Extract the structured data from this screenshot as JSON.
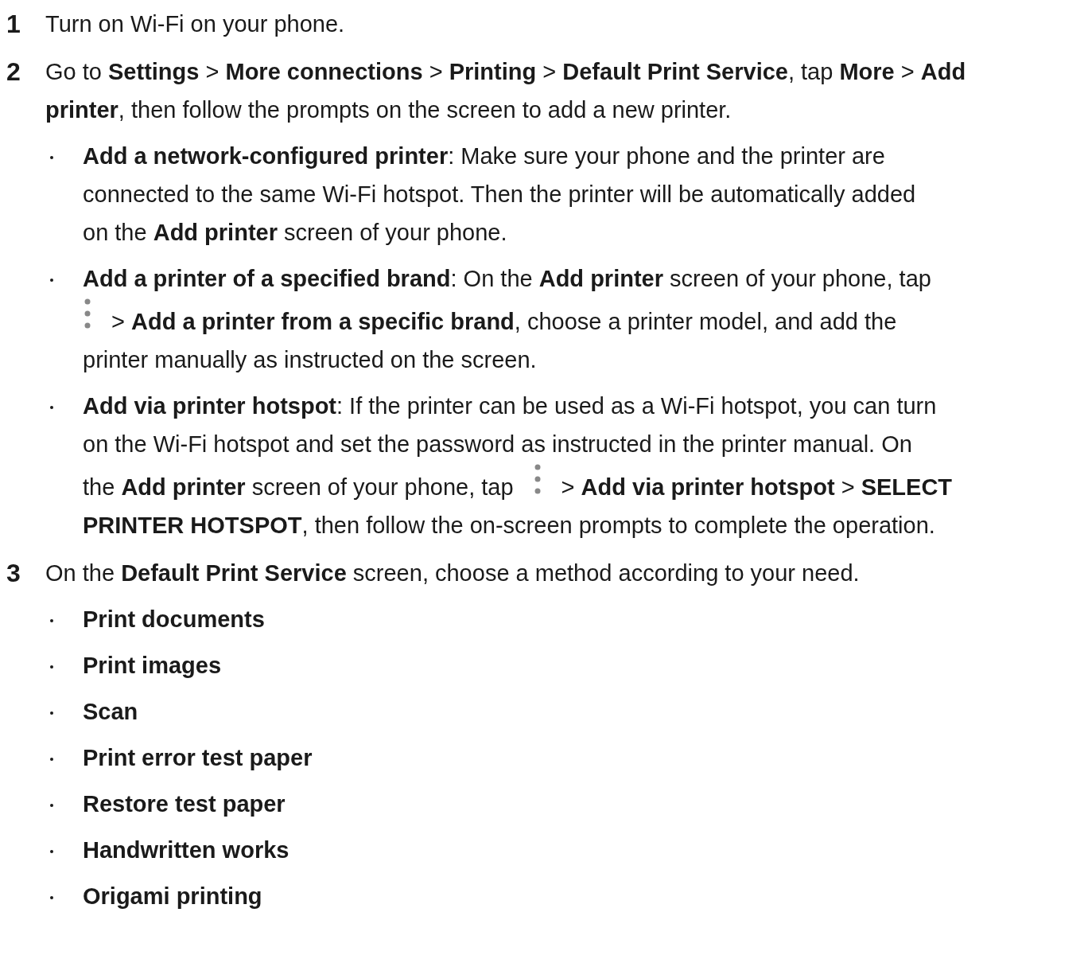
{
  "steps": [
    {
      "number": "1",
      "lines": [
        [
          "Turn on Wi-Fi on your phone."
        ]
      ]
    },
    {
      "number": "2",
      "lines": [
        [
          "Go to **Settings** > **More connections** > **Printing** > **Default Print Service**, tap **More** > **Add**"
        ],
        [
          "**printer**, then follow the prompts on the screen to add a new printer."
        ]
      ],
      "bullets": [
        {
          "lines": [
            [
              "**Add a network-configured printer**: Make sure your phone and the printer are"
            ],
            [
              "connected to the same Wi-Fi hotspot. Then the printer will be automatically added"
            ],
            [
              "on the **Add printer** screen of your phone."
            ]
          ]
        },
        {
          "lines": [
            [
              "**Add a printer of a specified brand**: On the **Add printer** screen of your phone, tap"
            ],
            [
              {
                "kind": "more_icon"
              },
              "> **Add a printer from a specific brand**, choose a printer model, and add the"
            ],
            [
              "printer manually as instructed on the screen."
            ]
          ]
        },
        {
          "lines": [
            [
              "**Add via printer hotspot**: If the printer can be used as a Wi-Fi hotspot, you can turn"
            ],
            [
              "on the Wi-Fi hotspot and set the password as instructed in the printer manual. On"
            ],
            [
              "the **Add printer** screen of your phone, tap",
              {
                "kind": "more_icon"
              },
              "> **Add via printer hotspot** > **SELECT**"
            ],
            [
              "**PRINTER HOTSPOT**, then follow the on-screen prompts to complete the operation."
            ]
          ]
        }
      ]
    },
    {
      "number": "3",
      "lines": [
        [
          "On the **Default Print Service** screen, choose a method according to your need."
        ]
      ],
      "bullets": [
        {
          "lines": [
            [
              "**Print documents**"
            ]
          ]
        },
        {
          "lines": [
            [
              "**Print images**"
            ]
          ]
        },
        {
          "lines": [
            [
              "**Scan**"
            ]
          ]
        },
        {
          "lines": [
            [
              "**Print error test paper**"
            ]
          ]
        },
        {
          "lines": [
            [
              "**Restore test paper**"
            ]
          ]
        },
        {
          "lines": [
            [
              "**Handwritten works**"
            ]
          ]
        },
        {
          "lines": [
            [
              "**Origami printing**"
            ]
          ]
        }
      ]
    }
  ]
}
